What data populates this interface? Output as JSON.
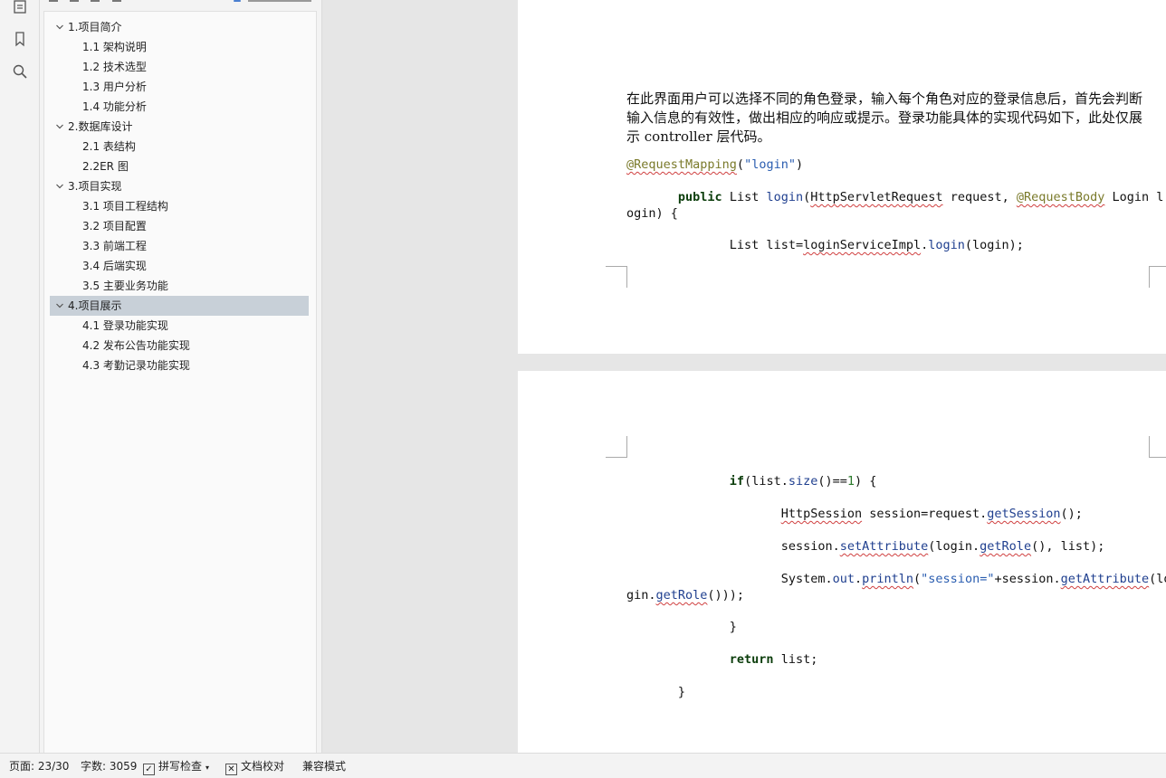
{
  "rail": {
    "icons": [
      "outline-icon",
      "bookmark-icon",
      "search-icon"
    ]
  },
  "toc": [
    {
      "label": "1.项目简介",
      "level": 1,
      "expanded": true
    },
    {
      "label": "1.1 架构说明",
      "level": 2
    },
    {
      "label": "1.2 技术选型",
      "level": 2
    },
    {
      "label": "1.3 用户分析",
      "level": 2
    },
    {
      "label": "1.4 功能分析",
      "level": 2
    },
    {
      "label": "2.数据库设计",
      "level": 1,
      "expanded": true
    },
    {
      "label": "2.1 表结构",
      "level": 2
    },
    {
      "label": "2.2ER 图",
      "level": 2
    },
    {
      "label": "3.项目实现",
      "level": 1,
      "expanded": true
    },
    {
      "label": "3.1 项目工程结构",
      "level": 2
    },
    {
      "label": "3.2 项目配置",
      "level": 2
    },
    {
      "label": "3.3 前端工程",
      "level": 2
    },
    {
      "label": "3.4 后端实现",
      "level": 2
    },
    {
      "label": "3.5 主要业务功能",
      "level": 2
    },
    {
      "label": "4.项目展示",
      "level": 1,
      "expanded": true,
      "active": true
    },
    {
      "label": "4.1  登录功能实现",
      "level": 2
    },
    {
      "label": "4.2  发布公告功能实现",
      "level": 2
    },
    {
      "label": "4.3  考勤记录功能实现",
      "level": 2
    }
  ],
  "document": {
    "paragraph": "在此界面用户可以选择不同的角色登录，输入每个角色对应的登录信息后，首先会判断输入信息的有效性，做出相应的响应或提示。登录功能具体的实现代码如下，此处仅展示 controller 层代码。",
    "code": {
      "annotation": "@RequestMapping",
      "mapping_arg": "\"login\"",
      "sig_public": "public",
      "sig_rest1": " List ",
      "sig_method": "login",
      "sig_open": "(",
      "sig_type": "HttpServletRequest",
      "sig_mid": " request, ",
      "sig_ann": "@RequestBody",
      "sig_tail": " Login l",
      "sig_wrap": "ogin) {",
      "list_decl_a": "List list=",
      "list_decl_impl": "loginServiceImpl",
      "list_decl_dot": ".",
      "list_decl_method": "login",
      "list_decl_end": "(login);",
      "if_kw": "if",
      "if_a": "(list.",
      "if_size": "size",
      "if_b": "()==",
      "if_num": "1",
      "if_c": ") {",
      "sess_type": "HttpSession",
      "sess_a": " session=request.",
      "sess_method": "getSession",
      "sess_b": "();",
      "set_a": "session.",
      "set_method": "setAttribute",
      "set_b": "(login.",
      "set_getrole": "getRole",
      "set_c": "(), list);",
      "print_a": "System.",
      "print_out": "out",
      "print_dot": ".",
      "print_method": "println",
      "print_b": "(",
      "print_str": "\"session=\"",
      "print_c": "+session.",
      "print_getattr": "getAttribute",
      "print_d": "(lo",
      "print_wrap_a": "gin.",
      "print_wrap_getrole": "getRole",
      "print_wrap_b": "()));",
      "close_if": "}",
      "return_kw": "return",
      "return_rest": " list;",
      "close_method": "}"
    }
  },
  "status": {
    "page": "页面: 23/30",
    "words": "字数: 3059",
    "spell": "拼写检查",
    "proof": "文档校对",
    "compat": "兼容模式"
  }
}
